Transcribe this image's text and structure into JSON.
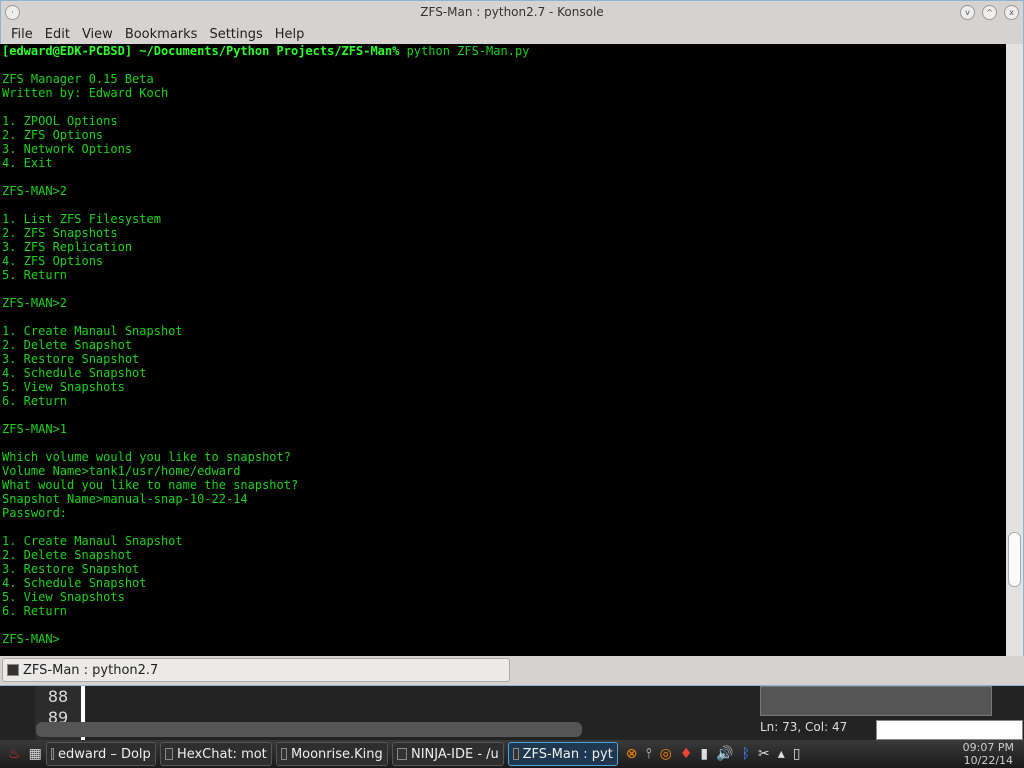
{
  "window": {
    "title": "ZFS-Man : python2.7 - Konsole"
  },
  "menu": [
    "File",
    "Edit",
    "View",
    "Bookmarks",
    "Settings",
    "Help"
  ],
  "terminal": {
    "prompt": "[edward@EDK-PCBSD] ~/Documents/Python Projects/ZFS-Man%",
    "command": " python ZFS-Man.py",
    "lines": [
      "",
      "ZFS Manager 0.15 Beta",
      "Written by: Edward Koch",
      "",
      "1. ZPOOL Options",
      "2. ZFS Options",
      "3. Network Options",
      "4. Exit",
      "",
      "ZFS-MAN>2",
      "",
      "1. List ZFS Filesystem",
      "2. ZFS Snapshots",
      "3. ZFS Replication",
      "4. ZFS Options",
      "5. Return",
      "",
      "ZFS-MAN>2",
      "",
      "1. Create Manaul Snapshot",
      "2. Delete Snapshot",
      "3. Restore Snapshot",
      "4. Schedule Snapshot",
      "5. View Snapshots",
      "6. Return",
      "",
      "ZFS-MAN>1",
      "",
      "Which volume would you like to snapshot?",
      "Volume Name>tank1/usr/home/edward",
      "What would you like to name the snapshot?",
      "Snapshot Name>manual-snap-10-22-14",
      "Password:",
      "",
      "1. Create Manaul Snapshot",
      "2. Delete Snapshot",
      "3. Restore Snapshot",
      "4. Schedule Snapshot",
      "5. View Snapshots",
      "6. Return",
      "",
      "ZFS-MAN>"
    ]
  },
  "tab": {
    "label": "ZFS-Man : python2.7"
  },
  "background": {
    "line_numbers": [
      "88",
      "89"
    ],
    "status": "Ln: 73, Col: 47"
  },
  "taskbar": {
    "tasks": [
      {
        "label": "edward – Dolp",
        "active": false
      },
      {
        "label": "HexChat: mot",
        "active": false
      },
      {
        "label": "Moonrise.King",
        "active": false
      },
      {
        "label": "NINJA-IDE - /u",
        "active": false
      },
      {
        "label": "ZFS-Man : pyt",
        "active": true
      }
    ],
    "time": "09:07 PM",
    "date": "10/22/14"
  }
}
